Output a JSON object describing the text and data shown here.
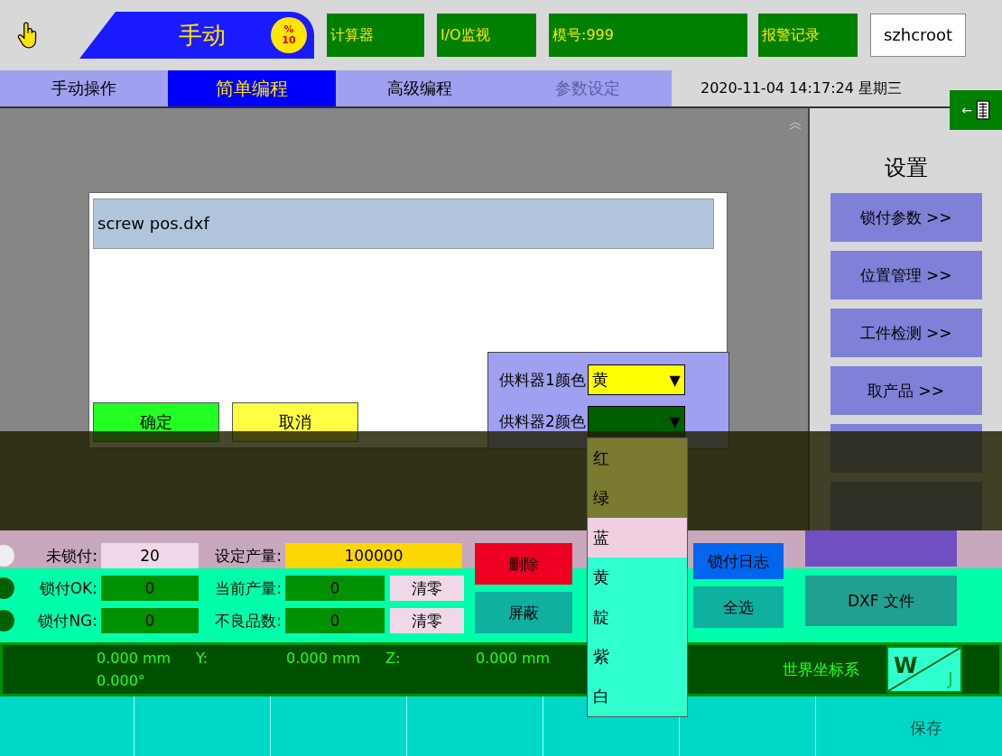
{
  "header": {
    "mode": "手动",
    "speed": {
      "unit": "%",
      "value": "10"
    },
    "buttons": [
      "计算器",
      "I/O监视",
      "模号:999"
    ],
    "alarm": "报警记录",
    "user": "szhcroot"
  },
  "tabs": [
    {
      "label": "手动操作",
      "selected": false,
      "disabled": false
    },
    {
      "label": "简单编程",
      "selected": true,
      "disabled": false
    },
    {
      "label": "高级编程",
      "selected": false,
      "disabled": false
    },
    {
      "label": "参数设定",
      "selected": false,
      "disabled": true
    }
  ],
  "datetime": "2020-11-04  14:17:24  星期三",
  "keyboard_arrow": "←",
  "sidebar": {
    "title": "设置",
    "buttons": [
      {
        "label": "锁付参数 >>"
      },
      {
        "label": "位置管理 >>"
      },
      {
        "label": "工件检测 >>"
      },
      {
        "label": "取产品 >>"
      }
    ]
  },
  "dialog": {
    "files": [
      {
        "name": "screw pos.dxf",
        "selected": true
      }
    ],
    "ok": "确定",
    "cancel": "取消"
  },
  "feeders": [
    {
      "label": "供料器1颜色",
      "value": "黄",
      "arrow": "▼",
      "color": "#ffff00"
    },
    {
      "label": "供料器2颜色",
      "arrow": "▼",
      "color": "#006000"
    }
  ],
  "dropdown": [
    "红",
    "绿",
    "蓝",
    "黄",
    "靛",
    "紫",
    "白"
  ],
  "counters": [
    {
      "label": "未锁付:",
      "value": "20",
      "kind": "plain",
      "label2": "设定产量:",
      "value2": "100000"
    },
    {
      "label": "锁付OK:",
      "value": "0",
      "kind": "green",
      "label2": "当前产量:",
      "value2": "0",
      "reset": "清零"
    },
    {
      "label": "锁付NG:",
      "value": "0",
      "kind": "green",
      "label2": "不良品数:",
      "value2": "0",
      "reset": "清零"
    }
  ],
  "actions": [
    {
      "label": "删除",
      "kind": "red"
    },
    {
      "label": "屏蔽",
      "kind": "teal"
    }
  ],
  "actions2": [
    {
      "label": "锁付日志",
      "kind": "blue"
    },
    {
      "label": "全选",
      "kind": "teal"
    }
  ],
  "file_buttons": [
    "DXF 文件"
  ],
  "coords": {
    "row1": [
      "0.000 mm",
      "Y:",
      "0.000 mm",
      "Z:",
      "0.000 mm"
    ],
    "row2": "0.000°",
    "system": "世界坐标系",
    "toggle": [
      "W",
      "J"
    ]
  },
  "footer": {
    "save": "保存"
  }
}
